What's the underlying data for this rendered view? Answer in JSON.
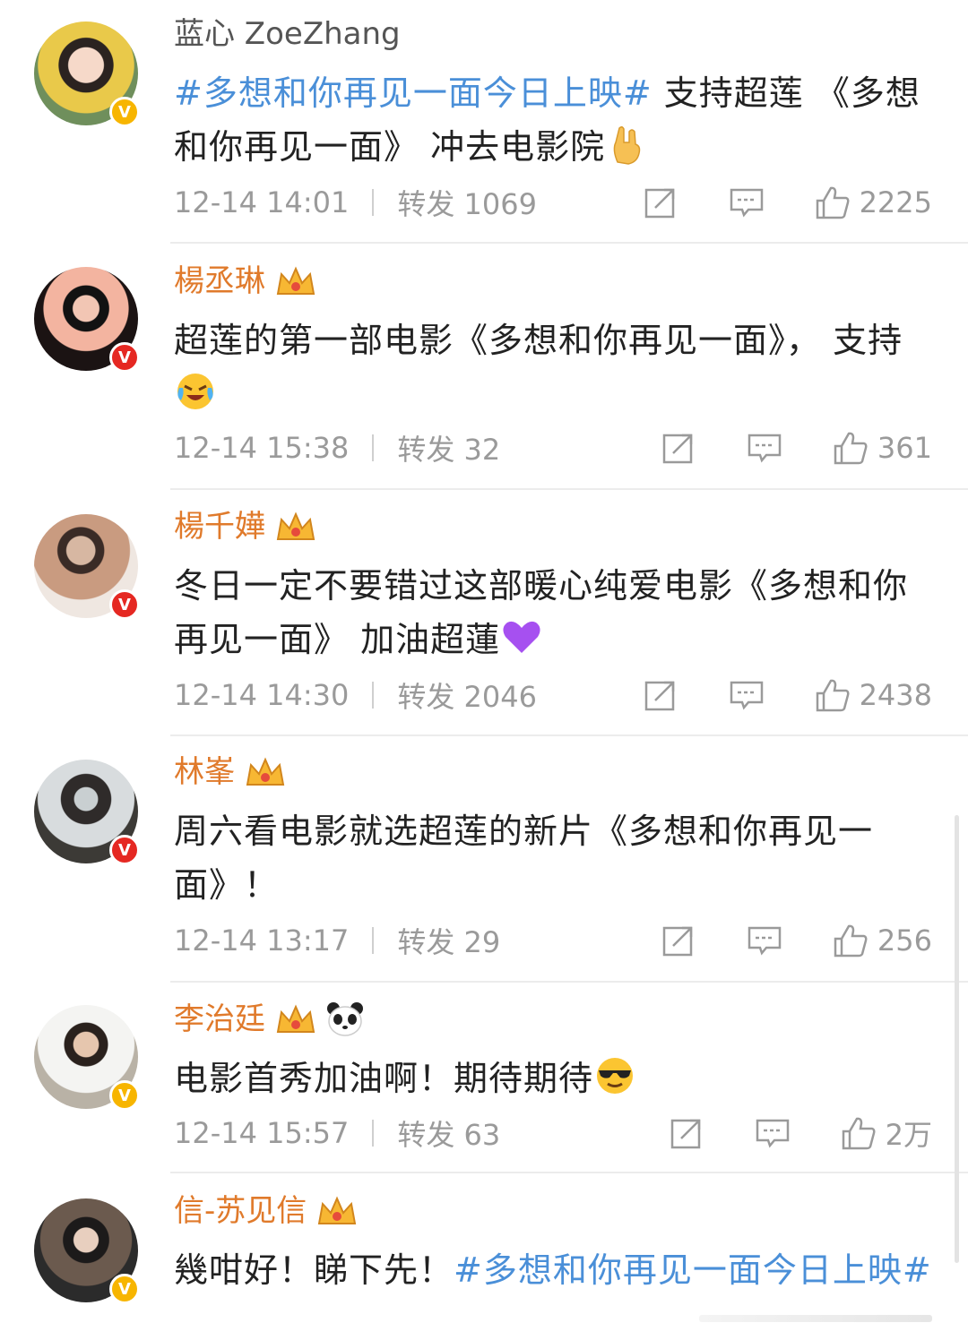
{
  "comments": [
    {
      "name": "蓝心 ZoeZhang",
      "name_style": "plain",
      "verified": "gold",
      "badges": [],
      "text_parts": [
        {
          "t": "#多想和你再见一面今日上映#",
          "tag": true
        },
        {
          "t": " 支持超莲 《多想和你再见一面》 冲去电影院",
          "tag": false
        }
      ],
      "emoji": "rock-hand-emoji",
      "time": "12-14 14:01",
      "repost": "转发 1069",
      "likes": "2225"
    },
    {
      "name": "楊丞琳",
      "name_style": "orange",
      "verified": "red",
      "badges": [
        "crown"
      ],
      "text_parts": [
        {
          "t": "超莲的第一部电影《多想和你再见一面》， 支持",
          "tag": false
        }
      ],
      "emoji": "tears-of-joy-emoji",
      "time": "12-14 15:38",
      "repost": "转发 32",
      "likes": "361"
    },
    {
      "name": "楊千嬅",
      "name_style": "orange",
      "verified": "red",
      "badges": [
        "crown"
      ],
      "text_parts": [
        {
          "t": "冬日一定不要错过这部暖心纯爱电影《多想和你再见一面》 加油超蓮",
          "tag": false
        }
      ],
      "emoji": "purple-heart-emoji",
      "time": "12-14 14:30",
      "repost": "转发 2046",
      "likes": "2438"
    },
    {
      "name": "林峯",
      "name_style": "orange",
      "verified": "red",
      "badges": [
        "crown"
      ],
      "text_parts": [
        {
          "t": "周六看电影就选超莲的新片《多想和你再见一面》！",
          "tag": false
        }
      ],
      "emoji": "",
      "time": "12-14 13:17",
      "repost": "转发 29",
      "likes": "256"
    },
    {
      "name": "李治廷",
      "name_style": "orange",
      "verified": "gold",
      "badges": [
        "crown",
        "panda"
      ],
      "text_parts": [
        {
          "t": "电影首秀加油啊！期待期待",
          "tag": false
        }
      ],
      "emoji": "sunglasses-emoji",
      "time": "12-14 15:57",
      "repost": "转发 63",
      "likes": "2万"
    },
    {
      "name": "信-苏见信",
      "name_style": "orange",
      "verified": "gold",
      "badges": [
        "crown"
      ],
      "text_parts": [
        {
          "t": "幾咁好！睇下先！",
          "tag": false
        },
        {
          "t": "#多想和你再见一面今日上映#",
          "tag": true
        }
      ],
      "emoji": "",
      "time": "",
      "repost": "",
      "likes": ""
    }
  ],
  "colors": {
    "name_orange": "#e07a2b",
    "hashtag_blue": "#4a8fd8",
    "meta_gray": "#9a9a9a",
    "verified_gold": "#f7b500",
    "verified_red": "#e52822"
  },
  "icons": {
    "share": "share-icon",
    "comment": "comment-icon",
    "like": "thumbs-up-icon",
    "vip": "crown-icon"
  }
}
